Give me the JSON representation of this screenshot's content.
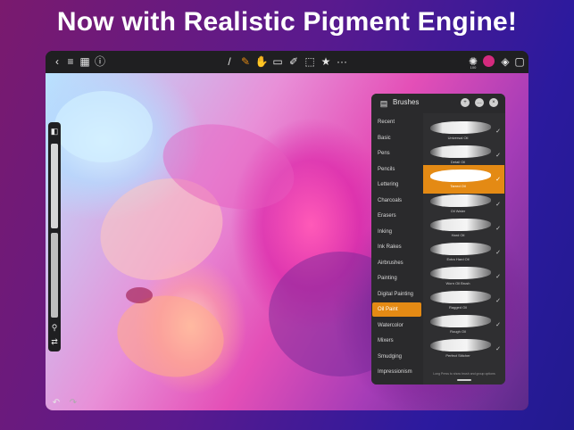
{
  "headline": "Now with Realistic Pigment Engine!",
  "toolbar": {
    "left_icons": [
      "back-icon",
      "menu-icon",
      "gallery-icon",
      "info-icon"
    ],
    "center_icons": [
      "brush-icon",
      "paint-icon",
      "smudge-icon",
      "eraser-icon",
      "eyedropper-icon",
      "selection-icon",
      "star-icon",
      "more-icon"
    ],
    "right_icons": [
      "brush-size-icon",
      "color-swatch",
      "layers-icon",
      "frame-icon"
    ],
    "brush_size_label": "100",
    "color": "#d42a7e"
  },
  "brushes_panel": {
    "title": "Brushes",
    "categories": [
      "Recent",
      "Basic",
      "Pens",
      "Pencils",
      "Lettering",
      "Charcoals",
      "Erasers",
      "Inking",
      "Ink Rakes",
      "Airbrushes",
      "Painting",
      "Digital Painting",
      "Oil Paint",
      "Watercolor",
      "Mixers",
      "Smudging",
      "Impressionism"
    ],
    "active_category": "Oil Paint",
    "brushes": [
      "Universal Oil",
      "Detail Oil",
      "Tarred Oil",
      "Oil Water",
      "Hard Oil",
      "Extra Hard Oil",
      "Worn Oil Brush",
      "Ragged Oil",
      "Rough Oil",
      "Perfect Stitcher"
    ],
    "active_brush": "Tarred Oil",
    "footnote": "Long Press to show brush and group options"
  },
  "colors": {
    "accent": "#e48a14",
    "panel_bg": "#2a2a2c",
    "toolbar_bg": "#1f1f21"
  }
}
